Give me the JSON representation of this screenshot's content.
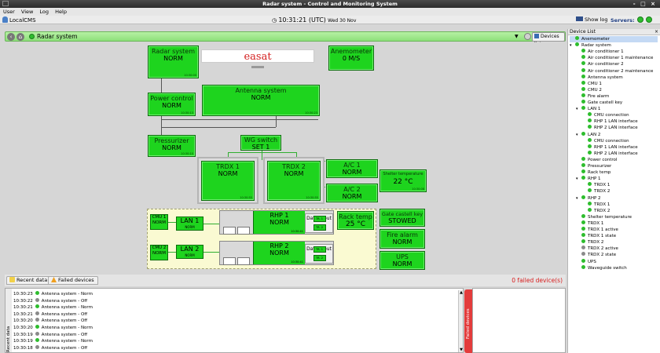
{
  "window": {
    "title": "Radar system - Control and Monitoring System",
    "controls": "- □ ×"
  },
  "menu": [
    "User",
    "View",
    "Log",
    "Help"
  ],
  "toolbar": {
    "cms": "LocalCMS",
    "time": "10:31:21 (UTC)",
    "date": "Wed 30 Nov",
    "show_log": "Show log",
    "servers": "Servers:"
  },
  "nav": {
    "title": "Radar system",
    "devices_list": "Devices list"
  },
  "diagram": {
    "logo": "easat",
    "radar": {
      "name": "Radar system",
      "state": "NORM",
      "ts": "10:30:00"
    },
    "anemometer": {
      "name": "Anemometer",
      "state": "0 M/S"
    },
    "antenna": {
      "name": "Antenna system",
      "state": "NORM",
      "ts": "10:30:23"
    },
    "power": {
      "name": "Power control",
      "state": "NORM",
      "ts": "10:30:13"
    },
    "pressurizer": {
      "name": "Pressurizer",
      "state": "NORM",
      "ts": "10:30:10"
    },
    "wg": {
      "name": "WG switch",
      "state": "SET 1"
    },
    "trdx1": {
      "name": "TRDX 1",
      "state": "NORM",
      "ts": "10:30:55"
    },
    "trdx2": {
      "name": "TRDX 2",
      "state": "NORM",
      "ts": "10:30:55"
    },
    "ac1": {
      "name": "A/C 1",
      "state": "NORM"
    },
    "ac2": {
      "name": "A/C 2",
      "state": "NORM"
    },
    "shelter": {
      "name": "Shelter temperature",
      "state": "22 °C",
      "ts": "10:30:08"
    },
    "cmu1": {
      "name": "CMU 1",
      "state": "NORM"
    },
    "cmu2": {
      "name": "CMU 2",
      "state": "NORM"
    },
    "lan1": {
      "name": "LAN 1",
      "state": "NORM"
    },
    "lan2": {
      "name": "LAN 2",
      "state": "NORM"
    },
    "rhp1": {
      "name": "RHP 1",
      "state": "NORM",
      "ts": "10:30:41",
      "data_input": "Data Input",
      "di1": "TR. 1",
      "di2": "TR. 2"
    },
    "rhp2": {
      "name": "RHP 2",
      "state": "NORM",
      "ts": "10:30:41",
      "data_input": "Data Input",
      "di1": "TR. 1",
      "di2": "TR. 2"
    },
    "rack": {
      "name": "Rack temp",
      "state": "25 °C"
    },
    "gate": {
      "name": "Gate castell key",
      "state": "STOWED"
    },
    "fire": {
      "name": "Fire alarm",
      "state": "NORM"
    },
    "ups": {
      "name": "UPS",
      "state": "NORM"
    }
  },
  "tabs": {
    "recent": "Recent data",
    "failed": "Failed devices",
    "failed_count": "0 failed device(s)"
  },
  "log_side_label": "Recent data",
  "failed_side_label": "Failed devices",
  "log": [
    {
      "time": "10:30:23",
      "text": "Antenna system - Norm",
      "status": "norm"
    },
    {
      "time": "10:30:22",
      "text": "Antenna system - Off",
      "status": "off"
    },
    {
      "time": "10:30:21",
      "text": "Antenna system - Norm",
      "status": "norm"
    },
    {
      "time": "10:30:21",
      "text": "Antenna system - Off",
      "status": "off"
    },
    {
      "time": "10:30:20",
      "text": "Antenna system - Off",
      "status": "off"
    },
    {
      "time": "10:30:20",
      "text": "Antenna system - Norm",
      "status": "norm"
    },
    {
      "time": "10:30:19",
      "text": "Antenna system - Off",
      "status": "off"
    },
    {
      "time": "10:30:19",
      "text": "Antenna system - Norm",
      "status": "norm"
    },
    {
      "time": "10:30:18",
      "text": "Antenna system - Off",
      "status": "off"
    }
  ],
  "device_list": {
    "header": "Device List",
    "items": [
      {
        "label": "Anemometer",
        "level": 0,
        "status": "norm",
        "expand": "",
        "selected": true
      },
      {
        "label": "Radar system",
        "level": 0,
        "status": "norm",
        "expand": "▾"
      },
      {
        "label": "Air conditioner 1",
        "level": 1,
        "status": "norm",
        "expand": ""
      },
      {
        "label": "Air conditioner 1 maintenance",
        "level": 1,
        "status": "norm",
        "expand": ""
      },
      {
        "label": "Air conditioner 2",
        "level": 1,
        "status": "norm",
        "expand": ""
      },
      {
        "label": "Air conditioner 2 maintenance",
        "level": 1,
        "status": "norm",
        "expand": ""
      },
      {
        "label": "Antenna system",
        "level": 1,
        "status": "norm",
        "expand": ""
      },
      {
        "label": "CMU 1",
        "level": 1,
        "status": "norm",
        "expand": ""
      },
      {
        "label": "CMU 2",
        "level": 1,
        "status": "norm",
        "expand": ""
      },
      {
        "label": "Fire alarm",
        "level": 1,
        "status": "norm",
        "expand": ""
      },
      {
        "label": "Gate castell key",
        "level": 1,
        "status": "norm",
        "expand": ""
      },
      {
        "label": "LAN 1",
        "level": 1,
        "status": "norm",
        "expand": "▾"
      },
      {
        "label": "CMU connection",
        "level": 2,
        "status": "norm",
        "expand": ""
      },
      {
        "label": "RHP 1 LAN interface",
        "level": 2,
        "status": "norm",
        "expand": ""
      },
      {
        "label": "RHP 2 LAN interface",
        "level": 2,
        "status": "norm",
        "expand": ""
      },
      {
        "label": "LAN 2",
        "level": 1,
        "status": "norm",
        "expand": "▾"
      },
      {
        "label": "CMU connection",
        "level": 2,
        "status": "norm",
        "expand": ""
      },
      {
        "label": "RHP 1 LAN interface",
        "level": 2,
        "status": "norm",
        "expand": ""
      },
      {
        "label": "RHP 2 LAN interface",
        "level": 2,
        "status": "norm",
        "expand": ""
      },
      {
        "label": "Power control",
        "level": 1,
        "status": "norm",
        "expand": ""
      },
      {
        "label": "Pressurizer",
        "level": 1,
        "status": "norm",
        "expand": ""
      },
      {
        "label": "Rack temp",
        "level": 1,
        "status": "norm",
        "expand": ""
      },
      {
        "label": "RHP 1",
        "level": 1,
        "status": "norm",
        "expand": "▾"
      },
      {
        "label": "TRDX 1",
        "level": 2,
        "status": "norm",
        "expand": ""
      },
      {
        "label": "TRDX 2",
        "level": 2,
        "status": "norm",
        "expand": ""
      },
      {
        "label": "RHP 2",
        "level": 1,
        "status": "norm",
        "expand": "▾"
      },
      {
        "label": "TRDX 1",
        "level": 2,
        "status": "norm",
        "expand": ""
      },
      {
        "label": "TRDX 2",
        "level": 2,
        "status": "norm",
        "expand": ""
      },
      {
        "label": "Shelter temperature",
        "level": 1,
        "status": "norm",
        "expand": ""
      },
      {
        "label": "TRDX 1",
        "level": 1,
        "status": "norm",
        "expand": ""
      },
      {
        "label": "TRDX 1 active",
        "level": 1,
        "status": "norm",
        "expand": ""
      },
      {
        "label": "TRDX 1 state",
        "level": 1,
        "status": "norm",
        "expand": ""
      },
      {
        "label": "TRDX 2",
        "level": 1,
        "status": "norm",
        "expand": ""
      },
      {
        "label": "TRDX 2 active",
        "level": 1,
        "status": "off",
        "expand": ""
      },
      {
        "label": "TRDX 2 state",
        "level": 1,
        "status": "off",
        "expand": ""
      },
      {
        "label": "UPS",
        "level": 1,
        "status": "norm",
        "expand": ""
      },
      {
        "label": "Waveguide switch",
        "level": 1,
        "status": "norm",
        "expand": ""
      }
    ]
  },
  "colors": {
    "norm": "#2ebd2e",
    "off": "#8a8a8a",
    "box_green": "#1ed41e",
    "alert": "#d81e1e"
  }
}
